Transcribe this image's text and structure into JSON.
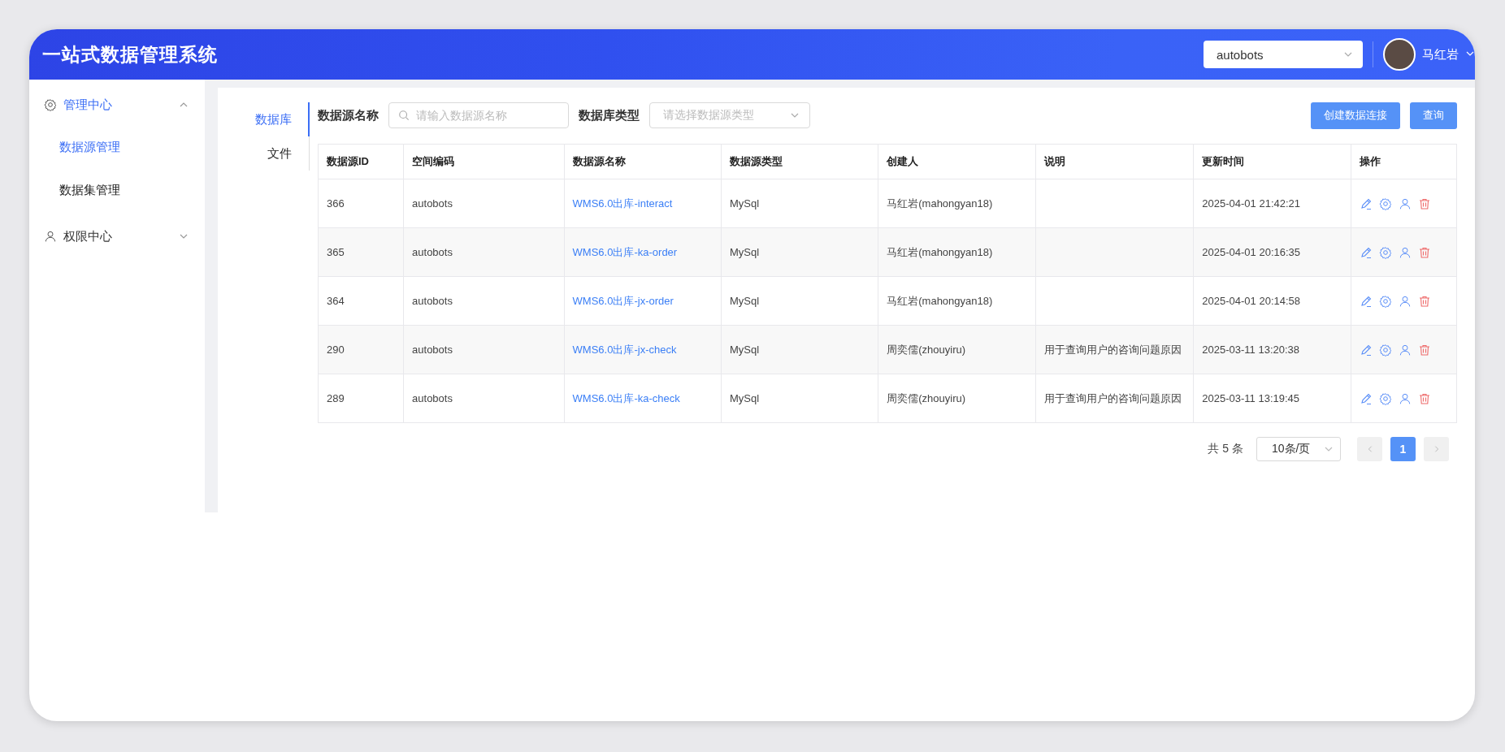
{
  "header": {
    "title": "一站式数据管理系统",
    "workspace_select": {
      "value": "autobots"
    },
    "user": {
      "name": "马红岩"
    }
  },
  "sidebar": {
    "items": [
      {
        "label": "管理中心",
        "kind": "gear",
        "expanded": true,
        "children": [
          {
            "label": "数据源管理",
            "selected": true
          },
          {
            "label": "数据集管理",
            "selected": false
          }
        ]
      },
      {
        "label": "权限中心",
        "kind": "user",
        "expanded": false
      }
    ]
  },
  "tabs": [
    {
      "label": "数据库",
      "selected": true
    },
    {
      "label": "文件",
      "selected": false
    }
  ],
  "filters": {
    "name_label": "数据源名称",
    "name_placeholder": "请输入数据源名称",
    "type_label": "数据库类型",
    "type_placeholder": "请选择数据源类型"
  },
  "buttons": [
    {
      "label": "创建数据连接"
    },
    {
      "label": "查询"
    }
  ],
  "table": {
    "columns": [
      "数据源ID",
      "空间编码",
      "数据源名称",
      "数据源类型",
      "创建人",
      "说明",
      "更新时间",
      "操作"
    ],
    "rows": [
      {
        "id": "366",
        "space": "autobots",
        "name": "WMS6.0出库-interact",
        "type": "MySql",
        "creator": "马红岩(mahongyan18)",
        "note": "",
        "updated": "2025-04-01 21:42:21"
      },
      {
        "id": "365",
        "space": "autobots",
        "name": "WMS6.0出库-ka-order",
        "type": "MySql",
        "creator": "马红岩(mahongyan18)",
        "note": "",
        "updated": "2025-04-01 20:16:35"
      },
      {
        "id": "364",
        "space": "autobots",
        "name": "WMS6.0出库-jx-order",
        "type": "MySql",
        "creator": "马红岩(mahongyan18)",
        "note": "",
        "updated": "2025-04-01 20:14:58"
      },
      {
        "id": "290",
        "space": "autobots",
        "name": "WMS6.0出库-jx-check",
        "type": "MySql",
        "creator": "周奕儒(zhouyiru)",
        "note": "用于查询用户的咨询问题原因",
        "updated": "2025-03-11 13:20:38"
      },
      {
        "id": "289",
        "space": "autobots",
        "name": "WMS6.0出库-ka-check",
        "type": "MySql",
        "creator": "周奕儒(zhouyiru)",
        "note": "用于查询用户的咨询问题原因",
        "updated": "2025-03-11 13:19:45"
      }
    ]
  },
  "pagination": {
    "total": "共 5 条",
    "page_size": "10条/页",
    "pages": [
      {
        "label": "1",
        "selected": true
      }
    ]
  }
}
